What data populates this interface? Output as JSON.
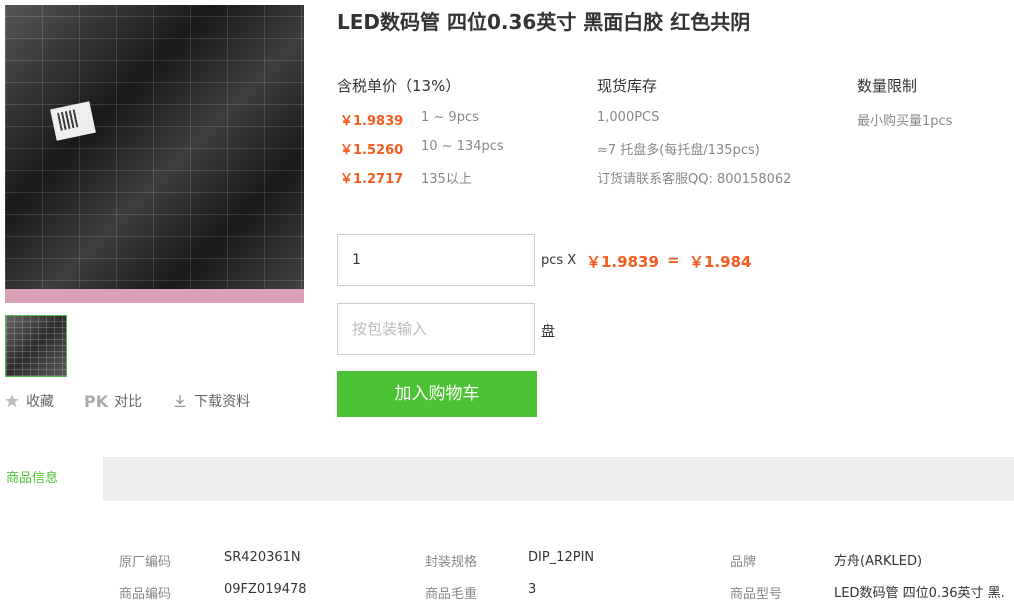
{
  "product": {
    "title": "LED数码管 四位0.36英寸 黑面白胶 红色共阴"
  },
  "actions": [
    {
      "label": "收藏",
      "icon": "star-icon"
    },
    {
      "label": "对比",
      "icon": "pk-icon",
      "prefix": "PK"
    },
    {
      "label": "下载资料",
      "icon": "download-icon"
    }
  ],
  "pricing": {
    "header": "含税单价（13%）",
    "tiers": [
      {
        "price": "￥1.9839",
        "range": "1 ~ 9pcs"
      },
      {
        "price": "￥1.5260",
        "range": "10 ~ 134pcs"
      },
      {
        "price": "￥1.2717",
        "range": "135以上"
      }
    ]
  },
  "stock": {
    "header": "现货库存",
    "lines": [
      "1,000PCS",
      "≈7 托盘多(每托盘/135pcs)",
      "订货请联系客服QQ: 800158062"
    ]
  },
  "limit": {
    "header": "数量限制",
    "text": "最小购买量1pcs"
  },
  "order": {
    "quantity_value": "1",
    "unit_label": "pcs X",
    "unit_price": "￥1.9839",
    "equals": "=",
    "total": "￥1.984",
    "package_placeholder": "按包装输入",
    "package_unit": "盘",
    "add_to_cart": "加入购物车"
  },
  "tabs": {
    "active": "商品信息"
  },
  "info": [
    {
      "label": "原厂编码",
      "value": "SR420361N"
    },
    {
      "label": "封装规格",
      "value": "DIP_12PIN"
    },
    {
      "label": "品牌",
      "value": "方舟(ARKLED)"
    },
    {
      "label": "商品编码",
      "value": "09FZ019478"
    },
    {
      "label": "商品毛重",
      "value": "3"
    },
    {
      "label": "商品型号",
      "value": "LED数码管 四位0.36英寸 黑."
    }
  ],
  "colors": {
    "accent_green": "#4cc235",
    "price_orange": "#f55a1e"
  }
}
